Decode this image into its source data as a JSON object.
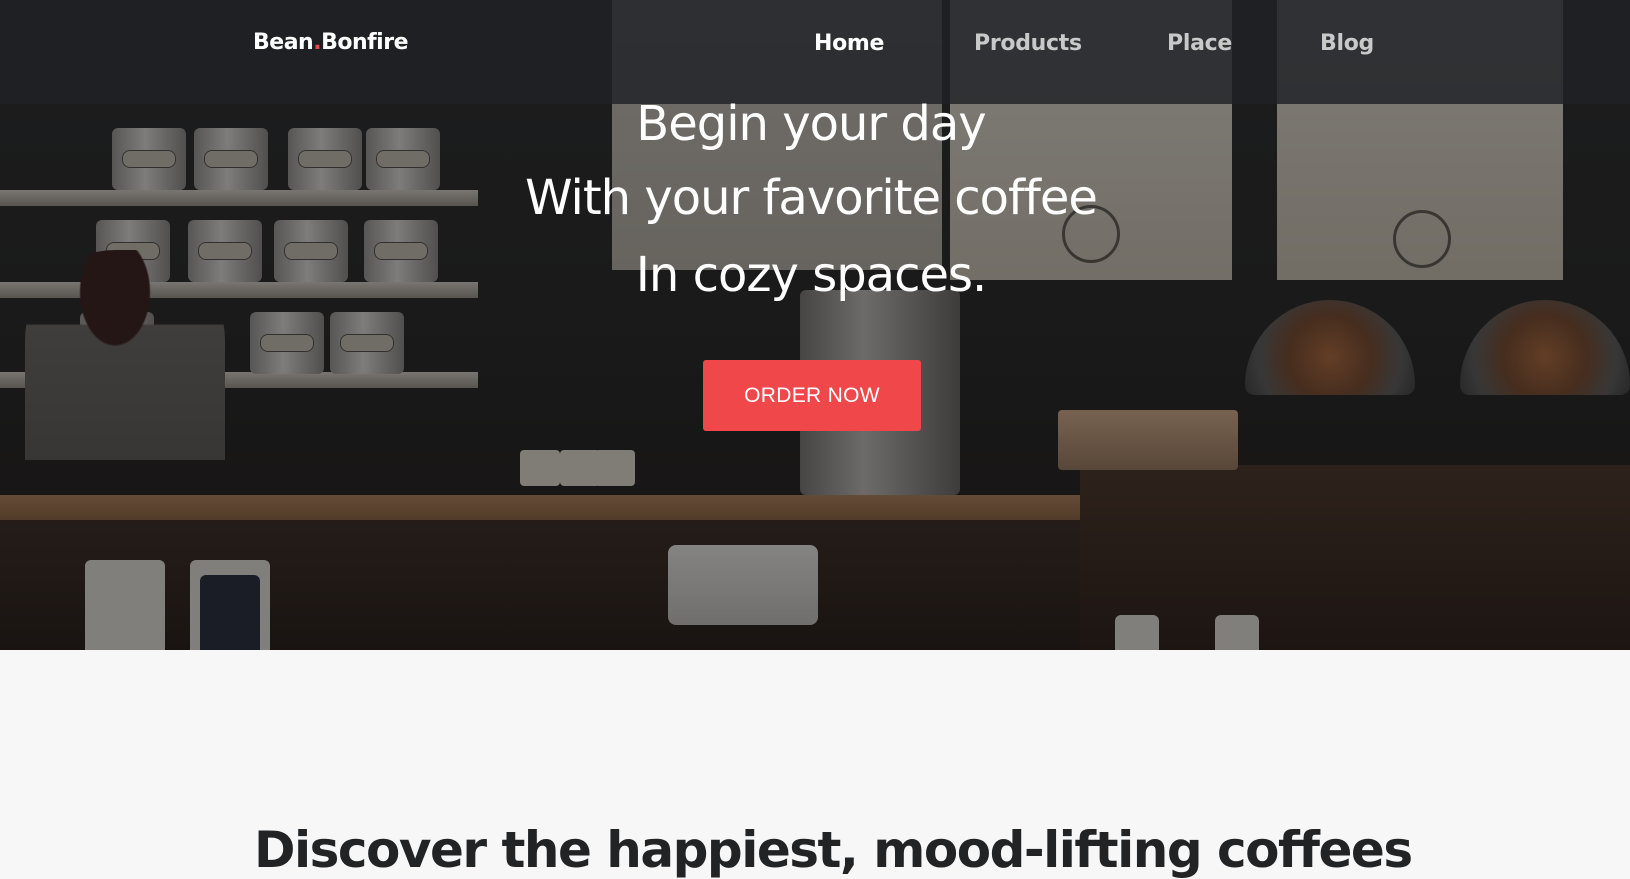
{
  "nav": {
    "brand_part1": "Bean",
    "brand_dot": ".",
    "brand_part2": "Bonfire",
    "links": [
      {
        "label": "Home",
        "active": true
      },
      {
        "label": "Products",
        "active": false
      },
      {
        "label": "Place",
        "active": false
      },
      {
        "label": "Blog",
        "active": false
      }
    ]
  },
  "hero": {
    "lines": [
      "Begin your day",
      "With your favorite coffee",
      "In cozy spaces."
    ],
    "cta_label": "ORDER NOW"
  },
  "section": {
    "title": "Discover the happiest, mood-lifting coffees"
  },
  "colors": {
    "accent": "#f0474b",
    "nav_bg": "#1e2126",
    "text_dark": "#212325",
    "page_bg": "#f7f7f7"
  }
}
